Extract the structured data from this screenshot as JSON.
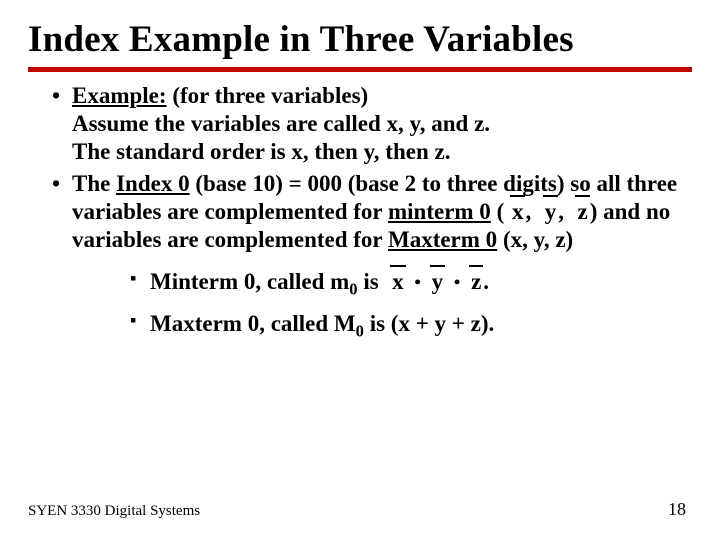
{
  "title": "Index Example in Three Variables",
  "bullet1": {
    "label": "Example:",
    "rest": " (for three variables)",
    "line2": "Assume the variables are called x, y, and z.",
    "line3": "The standard order is x, then y, then z."
  },
  "bullet2": {
    "p1": "The ",
    "u1": "Index 0",
    "p2": " (base 10) = 000 (base 2 to three digits) so all three variables are complemented for ",
    "u2": "minterm 0",
    "p3": " (",
    "var_x": "x",
    "comma1": ",",
    "var_y": "y",
    "comma2": ",",
    "var_z": "z",
    "p4": ") and no variables are complemented for ",
    "u3": "Maxterm 0",
    "p5": " (x, y, z)"
  },
  "sub1": {
    "p1": "Minterm 0, called m",
    "sub": "0",
    "p2": " is ",
    "x": "x",
    "y": "y",
    "z": "z",
    "end": "."
  },
  "sub2": {
    "p1": "Maxterm 0, called M",
    "sub": "0",
    "p2": " is (x + y + z)."
  },
  "footer": "SYEN 3330 Digital Systems",
  "page": "18",
  "glyphs": {
    "dot": "•"
  }
}
